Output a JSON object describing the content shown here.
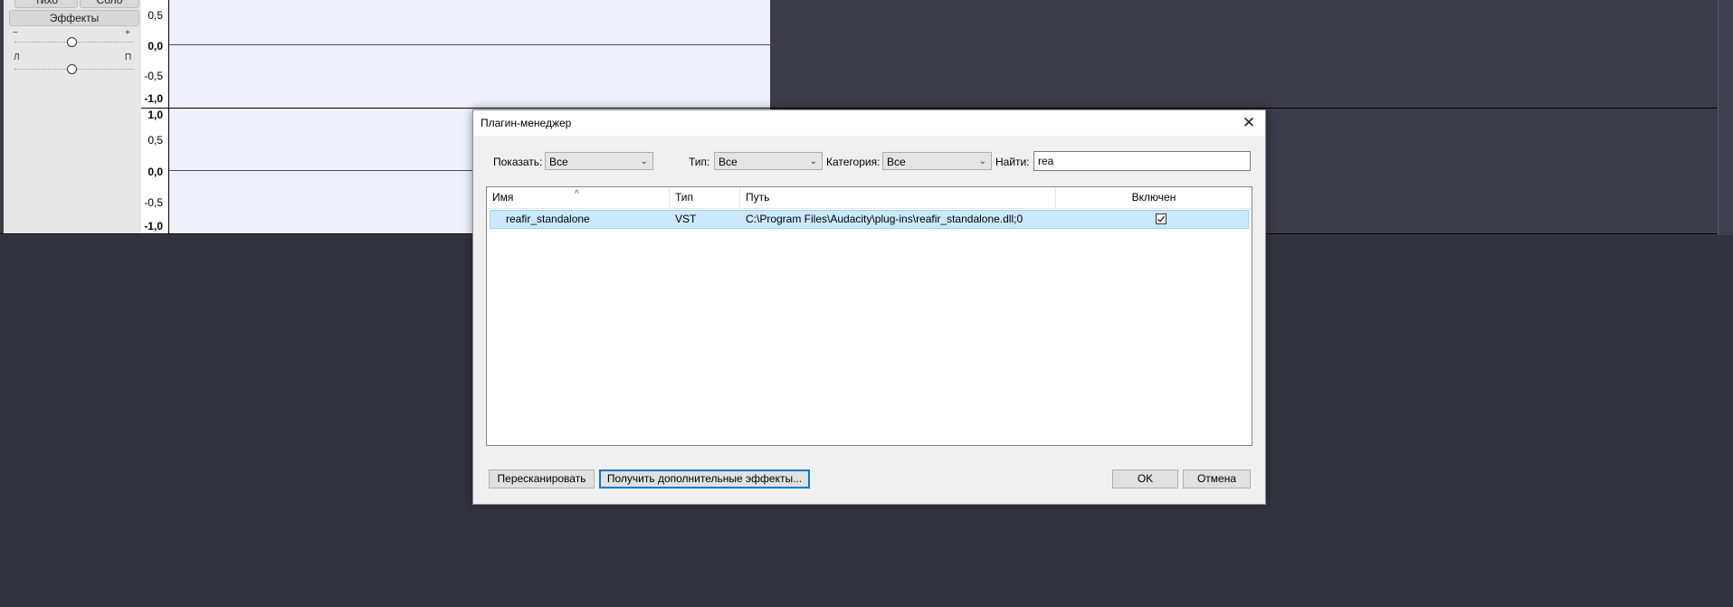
{
  "track": {
    "mute_label": "Тихо",
    "solo_label": "Соло",
    "effects_label": "Эффекты",
    "gain_minus": "−",
    "gain_plus": "+",
    "pan_left": "Л",
    "pan_right": "П"
  },
  "ruler_ticks": {
    "t1": [
      "0,5",
      "0,0",
      "-0,5",
      "-1,0"
    ],
    "t2": [
      "1,0",
      "0,5",
      "0,0",
      "-0,5",
      "-1,0"
    ]
  },
  "dialog": {
    "title": "Плагин-менеджер",
    "filters": {
      "show_label": "Показать:",
      "show_value": "Все",
      "type_label": "Тип:",
      "type_value": "Все",
      "category_label": "Категория:",
      "category_value": "Все",
      "find_label": "Найти:",
      "find_value": "rea"
    },
    "columns": {
      "name": "Имя",
      "type": "Тип",
      "path": "Путь",
      "enabled": "Включен"
    },
    "rows": [
      {
        "name": "reafir_standalone",
        "type": "VST",
        "path": "C:\\Program Files\\Audacity\\plug-ins\\reafir_standalone.dll;0",
        "enabled": true
      }
    ],
    "buttons": {
      "rescan": "Пересканировать",
      "get_more": "Получить дополнительные эффекты...",
      "ok": "OK",
      "cancel": "Отмена"
    }
  }
}
